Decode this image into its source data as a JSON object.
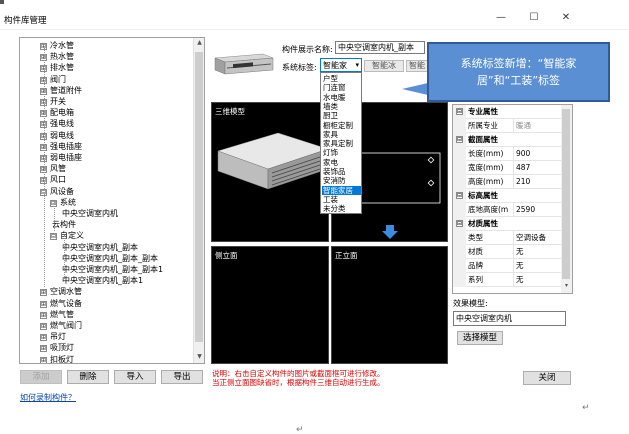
{
  "window": {
    "title": "构件库管理",
    "minimize": "—",
    "maximize": "☐",
    "close": "✕"
  },
  "tree": {
    "items": [
      {
        "label": "冷水管",
        "exp": "⊞"
      },
      {
        "label": "热水管",
        "exp": "⊞"
      },
      {
        "label": "排水管",
        "exp": "⊞"
      },
      {
        "label": "阀门",
        "exp": "⊞"
      },
      {
        "label": "管道附件",
        "exp": "⊞"
      },
      {
        "label": "开关",
        "exp": "⊞"
      },
      {
        "label": "配电箱",
        "exp": "⊞"
      },
      {
        "label": "强电线",
        "exp": "⊞"
      },
      {
        "label": "弱电线",
        "exp": "⊞"
      },
      {
        "label": "强电插座",
        "exp": "⊞"
      },
      {
        "label": "弱电插座",
        "exp": "⊞"
      },
      {
        "label": "风管",
        "exp": "⊞"
      },
      {
        "label": "风口",
        "exp": "⊞"
      },
      {
        "label": "风设备",
        "exp": "⊟"
      },
      {
        "label": "系统",
        "exp": "⊟"
      },
      {
        "label": "中央空调室内机",
        "exp": ""
      },
      {
        "label": "云构件",
        "exp": ""
      },
      {
        "label": "自定义",
        "exp": "⊟"
      },
      {
        "label": "中央空调室内机_副本",
        "exp": ""
      },
      {
        "label": "中央空调室内机_副本_副本",
        "exp": ""
      },
      {
        "label": "中央空调室内机_副本_副本1",
        "exp": ""
      },
      {
        "label": "中央空调室内机_副本1",
        "exp": ""
      },
      {
        "label": "空调水管",
        "exp": "⊞"
      },
      {
        "label": "燃气设备",
        "exp": "⊞"
      },
      {
        "label": "燃气管",
        "exp": "⊞"
      },
      {
        "label": "燃气阀门",
        "exp": "⊞"
      },
      {
        "label": "吊灯",
        "exp": "⊞"
      },
      {
        "label": "吸顶灯",
        "exp": "⊞"
      },
      {
        "label": "扣板灯",
        "exp": "⊞"
      }
    ],
    "scroll_up": "▲",
    "scroll_down": "▼"
  },
  "buttons": {
    "add": "添加",
    "delete": "删除",
    "import": "导入",
    "export": "导出",
    "select_model": "选择模型",
    "close": "关闭"
  },
  "link_record": "如何录制构件？",
  "form": {
    "name_label": "构件展示名称:",
    "name_value": "中央空调室内机_副本",
    "tag_label": "系统标签:",
    "tag_value": "智能家",
    "tag_chevron": "▾",
    "hidden_btn1": "智能冰",
    "hidden_btn2": "智能"
  },
  "dropdown": {
    "items": [
      "户型",
      "门连窗",
      "水电暖",
      "墙类",
      "厨卫",
      "橱柜定制",
      "家具",
      "家具定制",
      "灯饰",
      "家电",
      "装饰品",
      "安消防",
      "智能家居",
      "工装",
      "未分类"
    ],
    "selected_index": 12
  },
  "callout": {
    "line1": "系统标签新增：“智能家",
    "line2": "居”和“工装”标签"
  },
  "views": {
    "three_d": "三维模型",
    "side": "侧立面",
    "front": "正立面"
  },
  "props": {
    "rows": [
      {
        "type": "group",
        "key": "专业属性",
        "exp": "⊟"
      },
      {
        "type": "prop",
        "key": "所属专业",
        "value": "暖通",
        "disabled": true
      },
      {
        "type": "group",
        "key": "截面属性",
        "exp": "⊟"
      },
      {
        "type": "prop",
        "key": "长度(mm)",
        "value": "900"
      },
      {
        "type": "prop",
        "key": "宽度(mm)",
        "value": "487"
      },
      {
        "type": "prop",
        "key": "高度(mm)",
        "value": "210"
      },
      {
        "type": "group",
        "key": "标高属性",
        "exp": "⊟"
      },
      {
        "type": "prop",
        "key": "底地高度(m",
        "value": "2590"
      },
      {
        "type": "group",
        "key": "材质属性",
        "exp": "⊟"
      },
      {
        "type": "prop",
        "key": "类型",
        "value": "空调设备"
      },
      {
        "type": "prop",
        "key": "材质",
        "value": "无"
      },
      {
        "type": "prop",
        "key": "品牌",
        "value": "无"
      },
      {
        "type": "prop",
        "key": "系列",
        "value": "无"
      }
    ],
    "scroll_down": "▾"
  },
  "effect": {
    "label": "效果模型:",
    "value": "中央空调室内机"
  },
  "notes": {
    "line1": "说明：右击自定义构件的图片或截面框可进行修改。",
    "line2": "当正侧立面图缺省时，根据构件三维自动进行生成。"
  },
  "para_mark": "↵",
  "colors": {
    "accent": "#0078d7",
    "callout": "#5b8fd4",
    "note": "#e00000",
    "link": "#0645ad"
  }
}
